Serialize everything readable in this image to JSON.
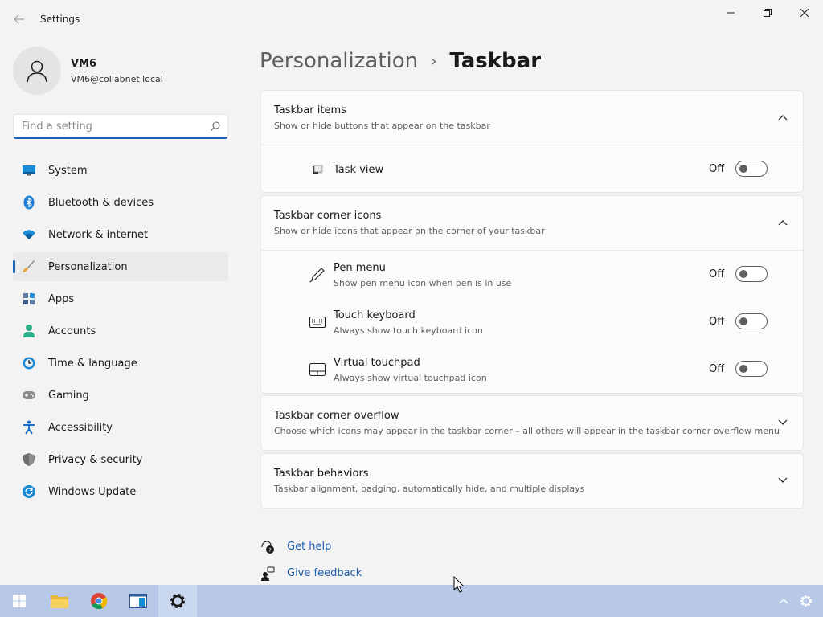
{
  "window": {
    "title": "Settings",
    "back_icon": "back-arrow-icon",
    "minimize_icon": "minimize-icon",
    "maximize_icon": "restore-icon",
    "close_icon": "close-icon"
  },
  "user": {
    "name": "VM6",
    "email": "VM6@collabnet.local",
    "avatar_icon": "person-icon"
  },
  "search": {
    "placeholder": "Find a setting",
    "value": "",
    "icon": "search-icon"
  },
  "nav": {
    "active_index": 3,
    "items": [
      {
        "label": "System",
        "icon": "system-display-icon"
      },
      {
        "label": "Bluetooth & devices",
        "icon": "bluetooth-icon"
      },
      {
        "label": "Network & internet",
        "icon": "wifi-icon"
      },
      {
        "label": "Personalization",
        "icon": "paintbrush-icon"
      },
      {
        "label": "Apps",
        "icon": "apps-icon"
      },
      {
        "label": "Accounts",
        "icon": "accounts-icon"
      },
      {
        "label": "Time & language",
        "icon": "clock-globe-icon"
      },
      {
        "label": "Gaming",
        "icon": "gamepad-icon"
      },
      {
        "label": "Accessibility",
        "icon": "accessibility-icon"
      },
      {
        "label": "Privacy & security",
        "icon": "shield-icon"
      },
      {
        "label": "Windows Update",
        "icon": "windows-update-icon"
      }
    ]
  },
  "breadcrumb": {
    "parent": "Personalization",
    "separator": "›",
    "current": "Taskbar"
  },
  "sections": {
    "taskbar_items": {
      "title": "Taskbar items",
      "description": "Show or hide buttons that appear on the taskbar",
      "expanded": true,
      "rows": [
        {
          "title": "Task view",
          "description": "",
          "state": "Off",
          "on": false,
          "icon": "task-view-icon"
        }
      ]
    },
    "corner_icons": {
      "title": "Taskbar corner icons",
      "description": "Show or hide icons that appear on the corner of your taskbar",
      "expanded": true,
      "rows": [
        {
          "title": "Pen menu",
          "description": "Show pen menu icon when pen is in use",
          "state": "Off",
          "on": false,
          "icon": "pen-icon"
        },
        {
          "title": "Touch keyboard",
          "description": "Always show touch keyboard icon",
          "state": "Off",
          "on": false,
          "icon": "keyboard-icon"
        },
        {
          "title": "Virtual touchpad",
          "description": "Always show virtual touchpad icon",
          "state": "Off",
          "on": false,
          "icon": "touchpad-icon"
        }
      ]
    },
    "corner_overflow": {
      "title": "Taskbar corner overflow",
      "description": "Choose which icons may appear in the taskbar corner – all others will appear in the taskbar corner overflow menu",
      "expanded": false
    },
    "behaviors": {
      "title": "Taskbar behaviors",
      "description": "Taskbar alignment, badging, automatically hide, and multiple displays",
      "expanded": false
    }
  },
  "help": {
    "get_help": "Get help",
    "give_feedback": "Give feedback"
  },
  "taskbar": {
    "items": [
      "start-icon",
      "file-explorer-icon",
      "chrome-icon",
      "app-window-icon",
      "settings-gear-icon"
    ],
    "active_item": "settings-gear-icon",
    "tray": [
      "show-hidden-icons-chevron-icon",
      "tray-settings-icon"
    ]
  },
  "colors": {
    "accent": "#1b5fb4",
    "taskbar": "#b7c9e6",
    "background": "#f3f3f3"
  }
}
